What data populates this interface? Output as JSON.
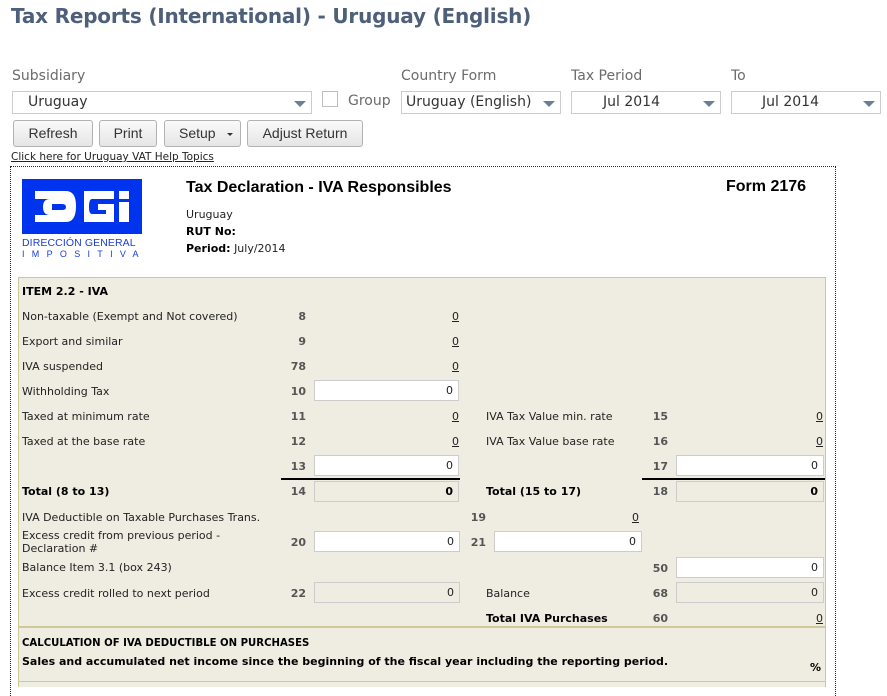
{
  "page": {
    "title": "Tax Reports (International) - Uruguay (English)"
  },
  "filters": {
    "subsidiary": {
      "label": "Subsidiary",
      "value": "Uruguay"
    },
    "group": {
      "label": "Group",
      "checked": false
    },
    "country_form": {
      "label": "Country Form",
      "value": "Uruguay (English)"
    },
    "tax_period": {
      "label": "Tax Period",
      "value": "Jul 2014"
    },
    "to": {
      "label": "To",
      "value": "Jul 2014"
    }
  },
  "toolbar": {
    "refresh_label": "Refresh",
    "print_label": "Print",
    "setup_label": "Setup",
    "adjust_return_label": "Adjust Return"
  },
  "help_link": "Click here for Uruguay VAT Help Topics",
  "report": {
    "logo": {
      "brand_color": "#0033ee",
      "line1": "DIRECCIÓN GENERAL",
      "line2": "IMPOSITIVA"
    },
    "title": "Tax Declaration - IVA Responsibles",
    "form_number": "Form 2176",
    "company": "Uruguay",
    "rut_label": "RUT No:",
    "rut_value": "",
    "period_label": "Period:",
    "period_value": "July/2014",
    "section1": {
      "heading": "ITEM 2.2 - IVA",
      "rows": [
        {
          "label": "Non-taxable (Exempt and Not covered)",
          "box": "8",
          "value": "0"
        },
        {
          "label": "Export and similar",
          "box": "9",
          "value": "0"
        },
        {
          "label": "IVA suspended",
          "box": "78",
          "value": "0"
        },
        {
          "label": "Withholding Tax",
          "box": "10",
          "value": "0"
        },
        {
          "label": "Taxed at minimum rate",
          "box": "11",
          "value": "0"
        },
        {
          "label": "Taxed at the base rate",
          "box": "12",
          "value": "0"
        },
        {
          "label": "",
          "box": "13",
          "value": "0"
        },
        {
          "label": "Total (8 to 13)",
          "box": "14",
          "value": "0"
        }
      ],
      "right_rows": [
        {
          "label": "IVA Tax Value min. rate",
          "box": "15",
          "value": "0"
        },
        {
          "label": "IVA Tax Value base rate",
          "box": "16",
          "value": "0"
        },
        {
          "label": "",
          "box": "17",
          "value": "0"
        },
        {
          "label": "Total (15 to 17)",
          "box": "18",
          "value": "0"
        }
      ],
      "deductible": {
        "label": "IVA Deductible on Taxable Purchases Trans.",
        "box": "19",
        "value": "0"
      },
      "excess_credit": {
        "label": "Excess credit from previous period - Declaration #",
        "box": "20",
        "value": "0",
        "box2": "21",
        "value2": "0"
      },
      "balance_item": {
        "label": "Balance Item 3.1 (box 243)",
        "box": "50",
        "value": "0"
      },
      "excess_rolled": {
        "label": "Excess credit rolled to next period",
        "box": "22",
        "value": "0"
      },
      "balance": {
        "label": "Balance",
        "box": "68",
        "value": "0"
      },
      "total_purchases": {
        "label": "Total IVA Purchases",
        "box": "60",
        "value": "0"
      }
    },
    "section2": {
      "heading": "CALCULATION OF IVA DEDUCTIBLE ON PURCHASES",
      "text": "Sales and accumulated net income since the beginning of the fiscal year including the reporting period.",
      "unit": "%"
    }
  }
}
